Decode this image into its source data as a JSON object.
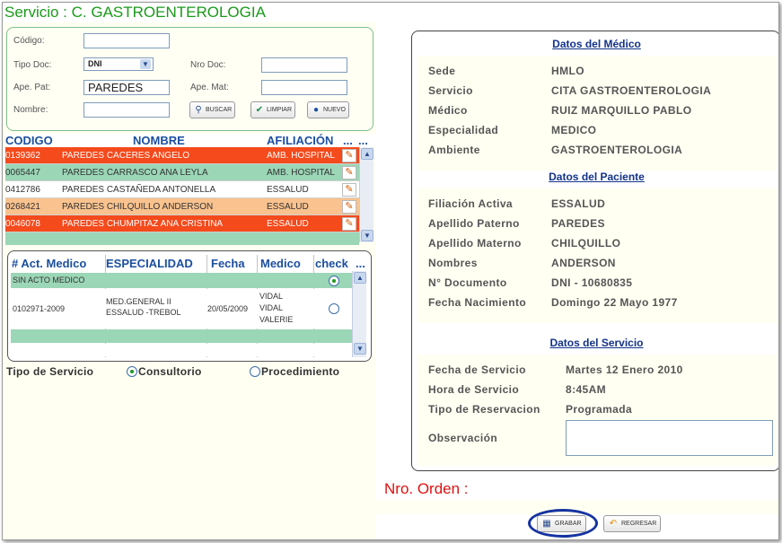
{
  "title": "Servicio : C. GASTROENTEROLOGIA",
  "search": {
    "codigo_label": "Código:",
    "codigo_value": "",
    "tipo_doc_label": "Tipo Doc:",
    "tipo_doc_value": "DNI",
    "nro_doc_label": "Nro Doc:",
    "nro_doc_value": "",
    "ape_pat_label": "Ape. Pat:",
    "ape_pat_value": "PAREDES",
    "ape_mat_label": "Ape. Mat:",
    "ape_mat_value": "",
    "nombre_label": "Nombre:",
    "nombre_value": "",
    "buscar_label": "BUSCAR",
    "limpiar_label": "LIMPIAR",
    "nuevo_label": "NUEVO"
  },
  "patients": {
    "headers": [
      "CODIGO",
      "NOMBRE",
      "AFILIACIÓN",
      "...",
      "..."
    ],
    "rows": [
      {
        "codigo": "0139362",
        "nombre": "PAREDES CACERES ANGELO",
        "afiliacion": "AMB. HOSPITAL"
      },
      {
        "codigo": "0065447",
        "nombre": "PAREDES CARRASCO ANA LEYLA",
        "afiliacion": "AMB. HOSPITAL"
      },
      {
        "codigo": "0412786",
        "nombre": "PAREDES CASTAÑEDA ANTONELLA",
        "afiliacion": "ESSALUD"
      },
      {
        "codigo": "0268421",
        "nombre": "PAREDES CHILQUILLO ANDERSON",
        "afiliacion": "ESSALUD"
      },
      {
        "codigo": "0046078",
        "nombre": "PAREDES CHUMPITAZ ANA CRISTINA",
        "afiliacion": "ESSALUD"
      }
    ],
    "row_colors": [
      "#f44a1c",
      "#9bd6b6",
      "#ffffff",
      "#f9c28e",
      "#f44a1c"
    ]
  },
  "acts": {
    "headers": [
      "# Act. Medico",
      "ESPECIALIDAD",
      "Fecha",
      "Medico",
      "check",
      "..."
    ],
    "row1_text": "SIN ACTO MEDICO",
    "row2": {
      "numero": "0102971-2009",
      "especialidad_1": "MED.GENERAL II",
      "especialidad_2": "ESSALUD -TREBOL",
      "fecha": "20/05/2009",
      "medico_1": "VIDAL",
      "medico_2": "VIDAL",
      "medico_3": "VALERIE"
    }
  },
  "tipo_servicio": {
    "label": "Tipo de Servicio",
    "opcion1": "Consultorio",
    "opcion2": "Procedimiento",
    "selected": "Consultorio"
  },
  "medico": {
    "title": "Datos del Médico",
    "sede_label": "Sede",
    "sede": "HMLO",
    "servicio_label": "Servicio",
    "servicio": "CITA GASTROENTEROLOGIA",
    "medico_label": "Médico",
    "medico": "RUIZ MARQUILLO PABLO",
    "especialidad_label": "Especialidad",
    "especialidad": "MEDICO",
    "ambiente_label": "Ambiente",
    "ambiente": "GASTROENTEROLOGIA"
  },
  "paciente": {
    "title": "Datos del Paciente",
    "filiacion_label": "Filiación Activa",
    "filiacion": "ESSALUD",
    "ape_pat_label": "Apellido Paterno",
    "ape_pat": "PAREDES",
    "ape_mat_label": "Apellido Materno",
    "ape_mat": "CHILQUILLO",
    "nombres_label": "Nombres",
    "nombres": "ANDERSON",
    "documento_label": "N° Documento",
    "documento": "DNI - 10680835",
    "nacimiento_label": "Fecha Nacimiento",
    "nacimiento": "Domingo 22 Mayo 1977"
  },
  "servicio": {
    "title": "Datos del Servicio",
    "fecha_label": "Fecha de Servicio",
    "fecha": "Martes 12 Enero 2010",
    "hora_label": "Hora de Servicio",
    "hora": "8:45AM",
    "reserva_label": "Tipo de Reservacion",
    "reserva": "Programada",
    "obs_label": "Observación",
    "obs_value": ""
  },
  "orden_label": "Nro. Orden :",
  "buttons": {
    "grabar": "GRABAR",
    "regresar": "REGRESAR"
  },
  "colors": {
    "title": "#1a9a1a",
    "header": "#1b4fa0",
    "orden": "#e01010",
    "highlight_ring": "#1533a0"
  }
}
